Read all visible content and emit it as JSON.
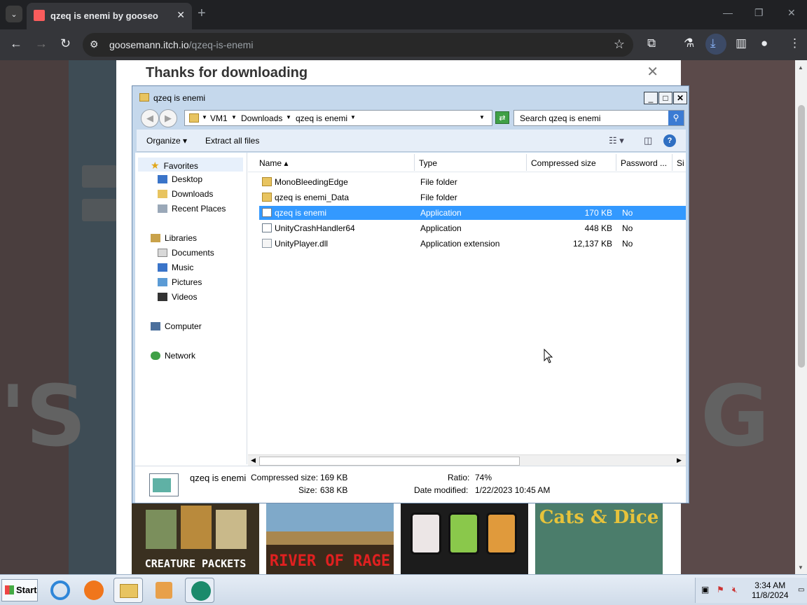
{
  "browser": {
    "tab_title": "qzeq is enemi by gooseo",
    "url_host": "goosemann.itch.io",
    "url_path": "/qzeq-is-enemi"
  },
  "page": {
    "modal_title": "Thanks for downloading",
    "games": [
      {
        "title": "CREATURE PACKETS",
        "color": "#ffffff"
      },
      {
        "title": "RIVER OF RAGE",
        "color": "#e02020"
      },
      {
        "title": "",
        "color": "#ffffff"
      },
      {
        "title": "Cats & Dice",
        "color": "#e7c33b"
      }
    ]
  },
  "explorer": {
    "title": "qzeq is enemi",
    "breadcrumbs": [
      "VM1",
      "Downloads",
      "qzeq is enemi"
    ],
    "search_placeholder": "Search qzeq is enemi",
    "commands": {
      "organize": "Organize",
      "extract": "Extract all files"
    },
    "nav": {
      "favorites": "Favorites",
      "fav_items": [
        "Desktop",
        "Downloads",
        "Recent Places"
      ],
      "libraries": "Libraries",
      "lib_items": [
        "Documents",
        "Music",
        "Pictures",
        "Videos"
      ],
      "computer": "Computer",
      "network": "Network"
    },
    "columns": [
      "Name",
      "Type",
      "Compressed size",
      "Password ...",
      "Si"
    ],
    "files": [
      {
        "name": "MonoBleedingEdge",
        "type": "File folder",
        "size": "",
        "password": "",
        "icon": "folder-icon"
      },
      {
        "name": "qzeq is enemi_Data",
        "type": "File folder",
        "size": "",
        "password": "",
        "icon": "folder-icon"
      },
      {
        "name": "qzeq is enemi",
        "type": "Application",
        "size": "170 KB",
        "password": "No",
        "icon": "application-icon"
      },
      {
        "name": "UnityCrashHandler64",
        "type": "Application",
        "size": "448 KB",
        "password": "No",
        "icon": "application-icon"
      },
      {
        "name": "UnityPlayer.dll",
        "type": "Application extension",
        "size": "12,137 KB",
        "password": "No",
        "icon": "dll-icon"
      }
    ],
    "details": {
      "name": "qzeq is enemi",
      "compressed_label": "Compressed size:",
      "compressed_value": "169 KB",
      "size_label": "Size:",
      "size_value": "638 KB",
      "ratio_label": "Ratio:",
      "ratio_value": "74%",
      "modified_label": "Date modified:",
      "modified_value": "1/22/2023 10:45 AM"
    }
  },
  "taskbar": {
    "start": "Start",
    "time": "3:34 AM",
    "date": "11/8/2024"
  }
}
